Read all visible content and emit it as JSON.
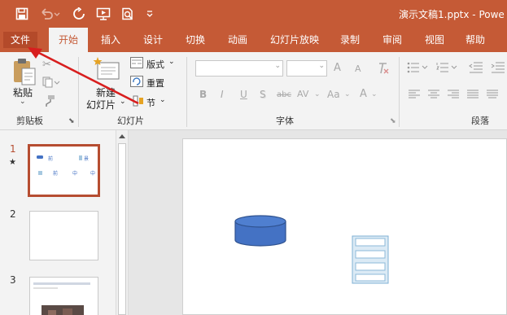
{
  "app": {
    "doc_title": "演示文稿1.pptx  -  Powe",
    "colors": {
      "accent": "#c55a36",
      "selected_thumb_border": "#b64d31",
      "shape_fill": "#4472c4",
      "annotation_arrow": "#d81e1e"
    }
  },
  "qat": {
    "save_icon": "save-icon",
    "undo_icon": "undo-icon",
    "redo_icon": "redo-icon",
    "present_icon": "present-icon",
    "preview_icon": "print-preview-icon",
    "customize_icon": "customize-dropdown-icon"
  },
  "tabs": [
    "文件",
    "开始",
    "插入",
    "设计",
    "切换",
    "动画",
    "幻灯片放映",
    "录制",
    "审阅",
    "视图",
    "帮助"
  ],
  "active_tab": "开始",
  "ribbon": {
    "clipboard": {
      "paste_label": "粘贴",
      "group_label": "剪贴板"
    },
    "slides": {
      "new_slide_line1": "新建",
      "new_slide_line2": "幻灯片",
      "layout_label": "版式",
      "reset_label": "重置",
      "section_label": "节",
      "group_label": "幻灯片"
    },
    "font": {
      "group_label": "字体",
      "bold": "B",
      "italic": "I",
      "underline": "U",
      "shadow": "S",
      "strike": "abc",
      "spacing": "AV",
      "case": "Aa",
      "font_color": "A",
      "grow": "A",
      "shrink": "A"
    },
    "paragraph": {
      "group_label": "段落"
    }
  },
  "slides_pane": {
    "items": [
      {
        "number": "1",
        "star": "★",
        "selected": true
      },
      {
        "number": "2",
        "star": "",
        "selected": false
      },
      {
        "number": "3",
        "star": "",
        "selected": false
      }
    ]
  },
  "thumb1": {
    "labels": [
      "前",
      "景",
      "前",
      "中",
      "中",
      "后"
    ]
  },
  "annotation": {
    "arrow_target": "文件"
  }
}
